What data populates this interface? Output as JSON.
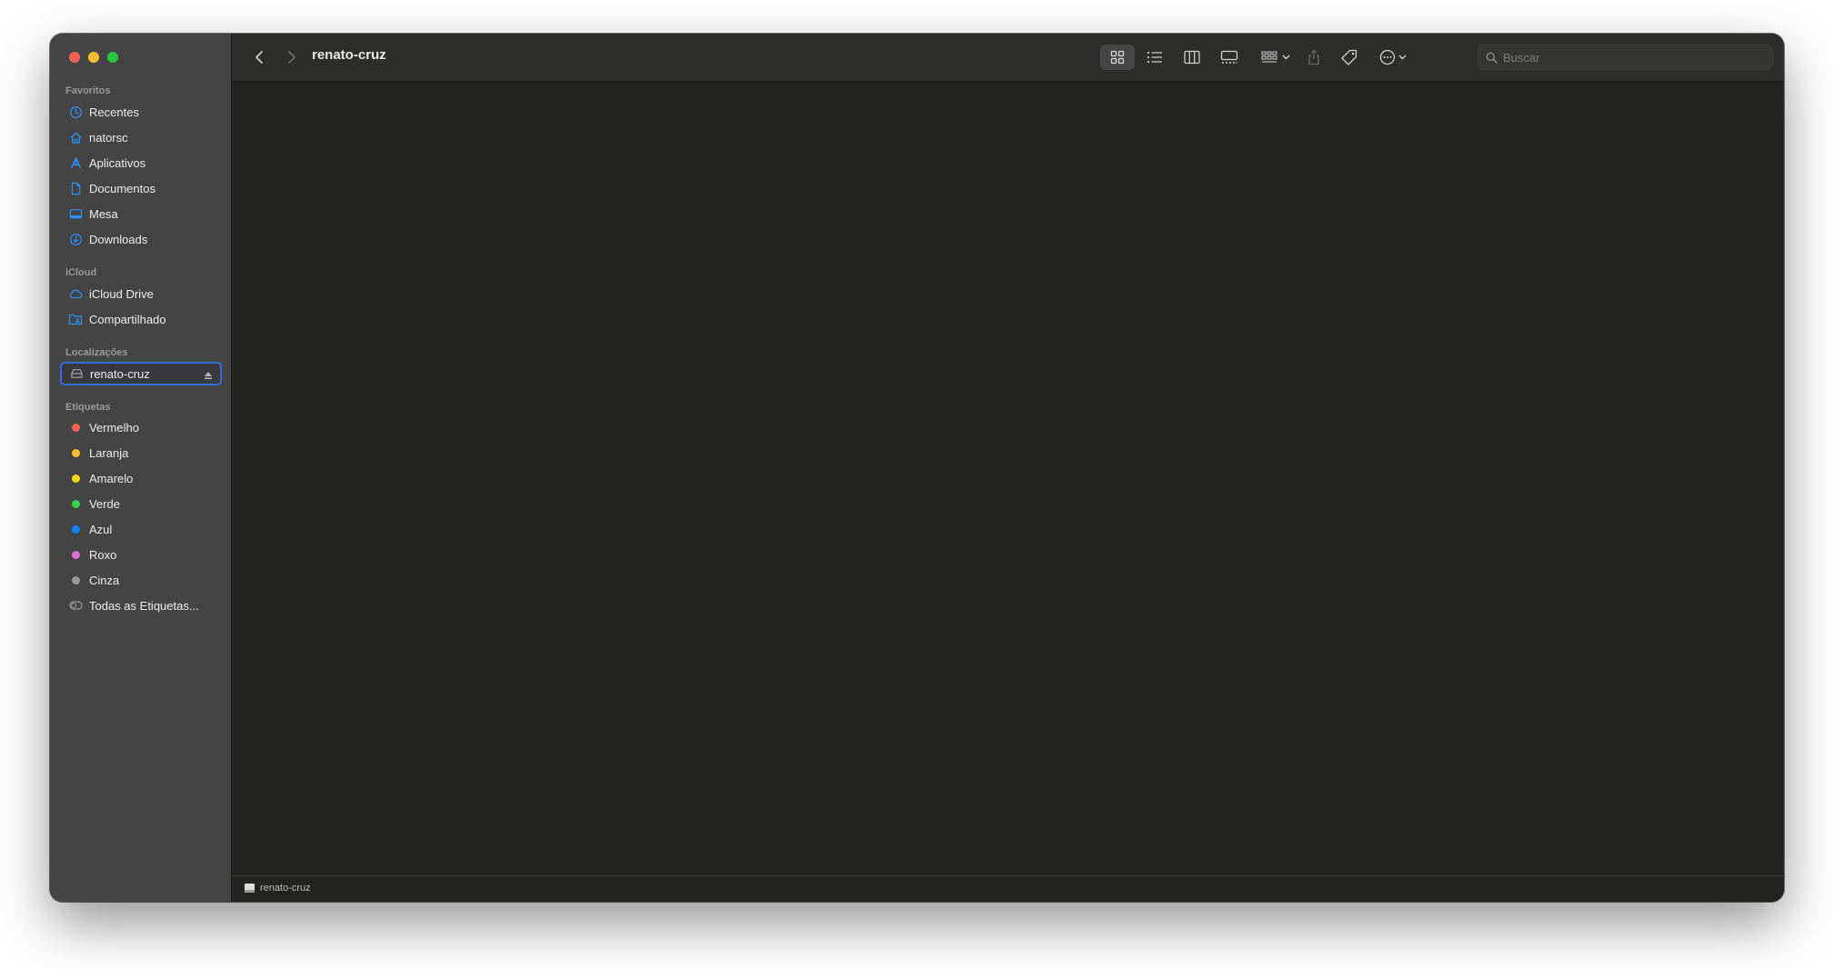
{
  "window": {
    "title": "renato-cruz"
  },
  "sidebar": {
    "sections": {
      "favorites": "Favoritos",
      "icloud": "iCloud",
      "locations": "Localizações",
      "tags": "Etiquetas"
    },
    "favorites": [
      {
        "label": "Recentes",
        "icon": "clock-icon"
      },
      {
        "label": "natorsc",
        "icon": "home-icon"
      },
      {
        "label": "Aplicativos",
        "icon": "applications-icon"
      },
      {
        "label": "Documentos",
        "icon": "document-icon"
      },
      {
        "label": "Mesa",
        "icon": "desktop-icon"
      },
      {
        "label": "Downloads",
        "icon": "download-icon"
      }
    ],
    "icloud": [
      {
        "label": "iCloud Drive",
        "icon": "cloud-icon"
      },
      {
        "label": "Compartilhado",
        "icon": "shared-folder-icon"
      }
    ],
    "locations": [
      {
        "label": "renato-cruz",
        "icon": "drive-icon",
        "selected": true
      }
    ],
    "tags": [
      {
        "label": "Vermelho",
        "color": "#ff5f57"
      },
      {
        "label": "Laranja",
        "color": "#febc2e"
      },
      {
        "label": "Amarelo",
        "color": "#ffd60a"
      },
      {
        "label": "Verde",
        "color": "#32d74b"
      },
      {
        "label": "Azul",
        "color": "#0a84ff"
      },
      {
        "label": "Roxo",
        "color": "#da70d6"
      },
      {
        "label": "Cinza",
        "color": "#98989d"
      },
      {
        "label": "Todas as Etiquetas...",
        "icon": "all-tags-icon"
      }
    ]
  },
  "toolbar": {
    "view_modes": [
      "icon-view-icon",
      "list-view-icon",
      "column-view-icon",
      "gallery-view-icon"
    ],
    "active_view": "icon-view-icon",
    "search_placeholder": "Buscar"
  },
  "statusbar": {
    "path": "renato-cruz"
  },
  "colors": {
    "accent": "#2f6fd8",
    "sidebar_icon": "#2e8ff2"
  }
}
